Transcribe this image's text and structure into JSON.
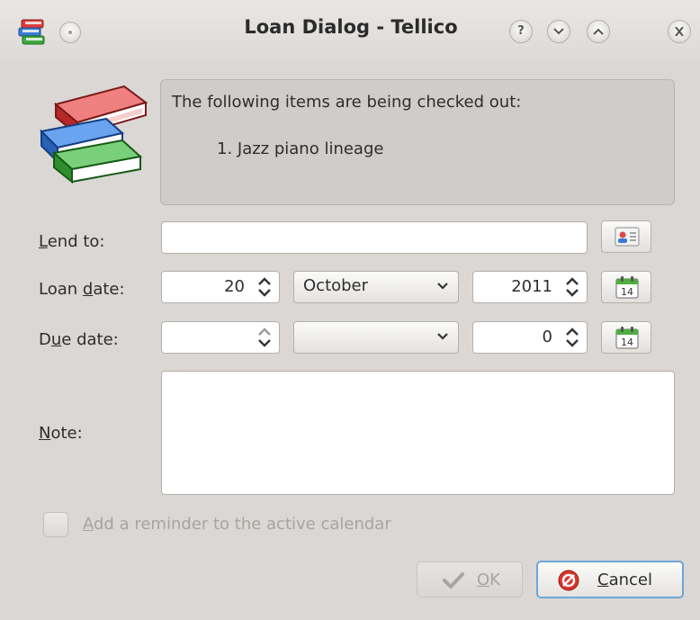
{
  "window": {
    "title": "Loan Dialog - Tellico",
    "help_symbol": "?"
  },
  "info": {
    "heading": "The following items are being checked out:",
    "items": [
      "1. Jazz piano lineage"
    ]
  },
  "lend_to": {
    "label_mnemonic": "L",
    "label_rest": "end to:",
    "value": ""
  },
  "loan_date": {
    "label_pre": "Loan ",
    "label_mnemonic": "d",
    "label_rest": "ate:",
    "day": "20",
    "month": "October",
    "year": "2011"
  },
  "due_date": {
    "label_pre": "D",
    "label_mnemonic": "u",
    "label_rest": "e date:",
    "day": "",
    "month": "",
    "year": "0"
  },
  "note": {
    "label_mnemonic": "N",
    "label_rest": "ote:",
    "value": ""
  },
  "calendar_day": "14",
  "reminder": {
    "mnemonic": "A",
    "rest": "dd a reminder to the active calendar",
    "checked": false
  },
  "buttons": {
    "ok_mnemonic": "O",
    "ok_rest": "K",
    "cancel_mnemonic": "C",
    "cancel_rest": "ancel"
  },
  "colors": {
    "book_red": "#e03a3a",
    "book_blue": "#3a7bd5",
    "book_green": "#3ea83e",
    "focus_border": "#6fa6d8",
    "cancel_icon": "#d9342b"
  }
}
